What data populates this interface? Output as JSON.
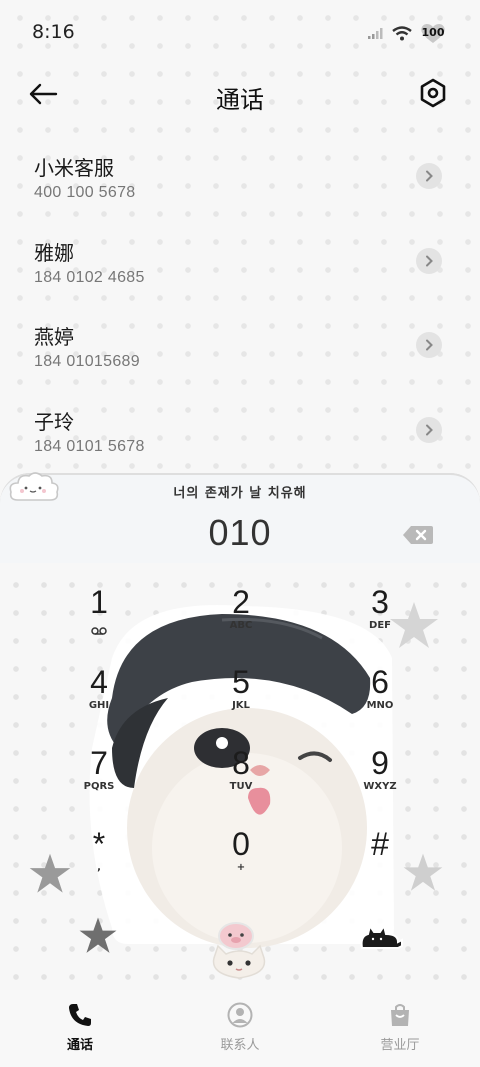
{
  "status": {
    "time": "8:16",
    "battery": "100"
  },
  "header": {
    "title": "通话"
  },
  "recents": [
    {
      "name": "小米客服",
      "number": "400 100 5678"
    },
    {
      "name": "雅娜",
      "number": "184 0102 4685"
    },
    {
      "name": "燕婷",
      "number": "184 01015689"
    },
    {
      "name": "子玲",
      "number": "184 0101 5678"
    }
  ],
  "dialer": {
    "caption": "너의 존재가 날 치유해",
    "number": "010",
    "keys": [
      {
        "digit": "1",
        "sub": ""
      },
      {
        "digit": "2",
        "sub": "ABC"
      },
      {
        "digit": "3",
        "sub": "DEF"
      },
      {
        "digit": "4",
        "sub": "GHI"
      },
      {
        "digit": "5",
        "sub": "JKL"
      },
      {
        "digit": "6",
        "sub": "MNO"
      },
      {
        "digit": "7",
        "sub": "PQRS"
      },
      {
        "digit": "8",
        "sub": "TUV"
      },
      {
        "digit": "9",
        "sub": "WXYZ"
      },
      {
        "digit": "*",
        "sub": ","
      },
      {
        "digit": "0",
        "sub": "+"
      },
      {
        "digit": "#",
        "sub": ""
      }
    ]
  },
  "nav": {
    "calls": "通话",
    "contacts": "联系人",
    "store": "营业厅"
  },
  "icons": {
    "back": "arrow-left-icon",
    "settings": "hexagon-settings-icon",
    "delete": "backspace-icon",
    "voicemail": "voicemail-icon",
    "chevron": "chevron-right-icon",
    "phone": "phone-icon",
    "contacts": "person-icon",
    "store": "bag-icon"
  }
}
